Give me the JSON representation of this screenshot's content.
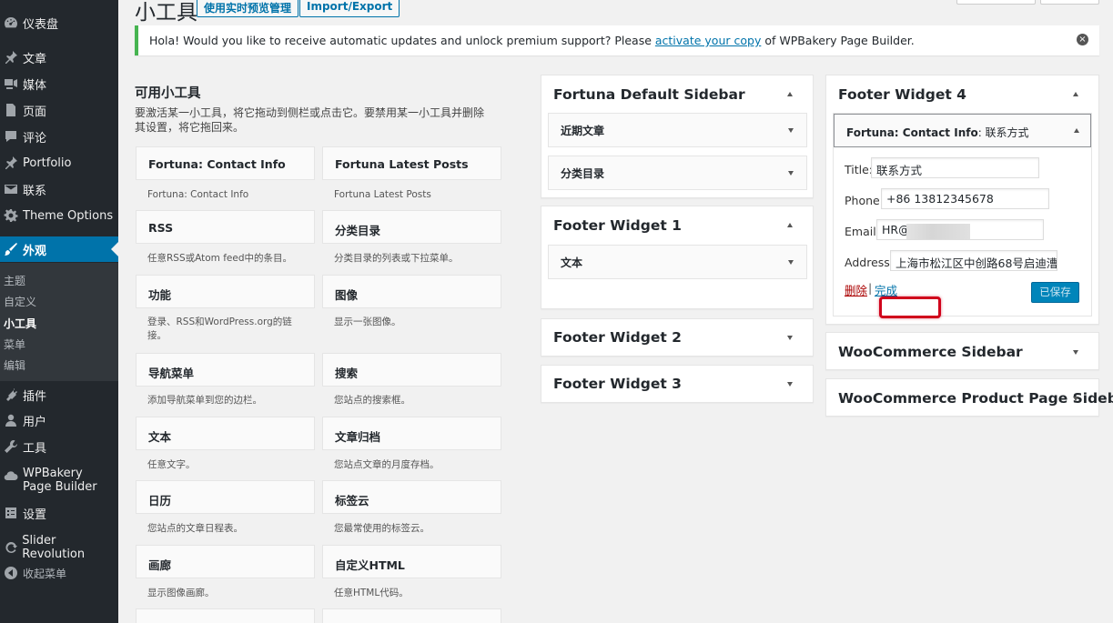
{
  "sidebar": {
    "items": [
      {
        "label": "仪表盘",
        "icon": "dashboard-icon"
      },
      {
        "label": "文章",
        "icon": "pin-icon"
      },
      {
        "label": "媒体",
        "icon": "media-icon"
      },
      {
        "label": "页面",
        "icon": "page-icon"
      },
      {
        "label": "评论",
        "icon": "comment-icon"
      },
      {
        "label": "Portfolio",
        "icon": "pin-icon"
      },
      {
        "label": "联系",
        "icon": "mail-icon"
      },
      {
        "label": "Theme Options",
        "icon": "gear-icon"
      },
      {
        "label": "外观",
        "icon": "brush-icon"
      },
      {
        "label": "插件",
        "icon": "plugin-icon"
      },
      {
        "label": "用户",
        "icon": "user-icon"
      },
      {
        "label": "工具",
        "icon": "wrench-icon"
      },
      {
        "label": "WPBakery Page Builder",
        "icon": "cloud-icon"
      },
      {
        "label": "设置",
        "icon": "settings-icon"
      },
      {
        "label": "Slider Revolution",
        "icon": "refresh-icon"
      },
      {
        "label": "收起菜单",
        "icon": "collapse-icon"
      }
    ],
    "submenu": [
      "主题",
      "自定义",
      "小工具",
      "菜单",
      "编辑"
    ]
  },
  "header": {
    "title": "小工具",
    "live_preview": "使用实时预览管理",
    "import_export": "Import/Export"
  },
  "notice": {
    "before": "Hola! Would you like to receive automatic updates and unlock premium support? Please ",
    "link": "activate your copy",
    "after": " of WPBakery Page Builder.",
    "dismiss": "×"
  },
  "available": {
    "title": "可用小工具",
    "description": "要激活某一小工具，将它拖动到侧栏或点击它。要禁用某一小工具并删除其设置，将它拖回来。",
    "widgets": [
      {
        "name": "Fortuna: Contact Info",
        "desc": "Fortuna: Contact Info"
      },
      {
        "name": "Fortuna Latest Posts",
        "desc": "Fortuna Latest Posts"
      },
      {
        "name": "RSS",
        "desc": "任意RSS或Atom feed中的条目。"
      },
      {
        "name": "分类目录",
        "desc": "分类目录的列表或下拉菜单。"
      },
      {
        "name": "功能",
        "desc": "登录、RSS和WordPress.org的链接。"
      },
      {
        "name": "图像",
        "desc": "显示一张图像。"
      },
      {
        "name": "导航菜单",
        "desc": "添加导航菜单到您的边栏。"
      },
      {
        "name": "搜索",
        "desc": "您站点的搜索框。"
      },
      {
        "name": "文本",
        "desc": "任意文字。"
      },
      {
        "name": "文章归档",
        "desc": "您站点文章的月度存档。"
      },
      {
        "name": "日历",
        "desc": "您站点的文章日程表。"
      },
      {
        "name": "标签云",
        "desc": "您最常使用的标签云。"
      },
      {
        "name": "画廊",
        "desc": "显示图像画廊。"
      },
      {
        "name": "自定义HTML",
        "desc": "任意HTML代码。"
      }
    ]
  },
  "sidebars": {
    "default": {
      "title": "Fortuna Default Sidebar",
      "widgets": [
        "近期文章",
        "分类目录"
      ]
    },
    "footer1": {
      "title": "Footer Widget 1",
      "widgets": [
        "文本"
      ]
    },
    "footer2": {
      "title": "Footer Widget 2"
    },
    "footer3": {
      "title": "Footer Widget 3"
    },
    "footer4": {
      "title": "Footer Widget 4"
    },
    "woo": {
      "title": "WooCommerce Sidebar"
    },
    "woo_product": {
      "title": "WooCommerce Product Page Sideb"
    }
  },
  "contact_widget": {
    "header_prefix": "Fortuna: Contact Info",
    "header_suffix": ": 联系方式",
    "title_label": "Title:",
    "title_value": "联系方式",
    "phone_label": "Phone:",
    "phone_value": "+86 13812345678",
    "email_label": "Email:",
    "email_value": "HR@",
    "address_label": "Address:",
    "address_value": "上海市松江区中创路68号启迪漕",
    "delete": "删除",
    "separator": "|",
    "done": "完成",
    "save": "已保存"
  },
  "colors": {
    "admin_bar": "#23282d",
    "accent": "#0073aa",
    "highlight_border": "#d0021b"
  }
}
